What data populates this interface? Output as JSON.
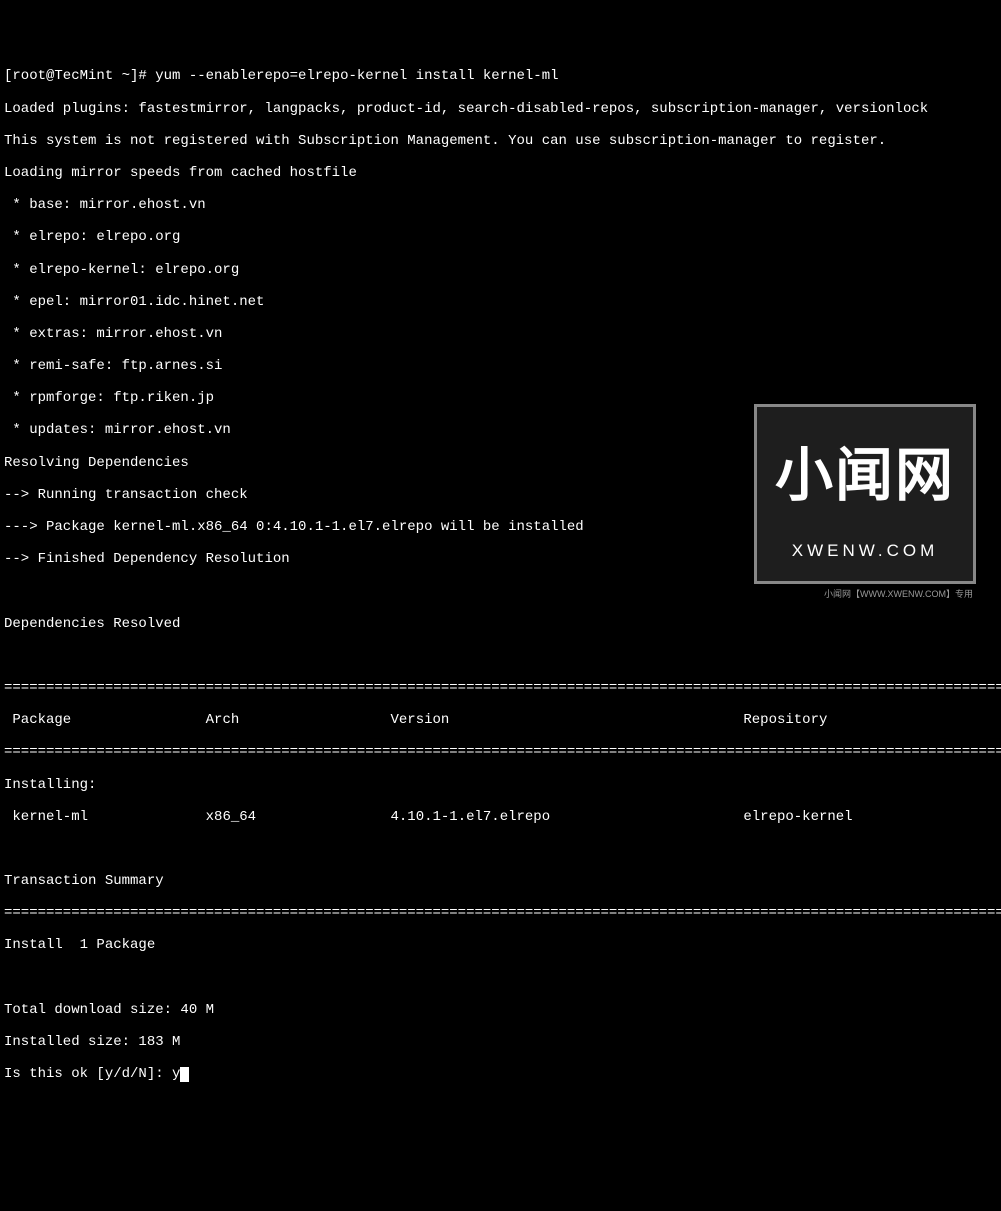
{
  "prompt": "[root@TecMint ~]# ",
  "command": "yum --enablerepo=elrepo-kernel install kernel-ml",
  "output": {
    "line1": "Loaded plugins: fastestmirror, langpacks, product-id, search-disabled-repos, subscription-manager, versionlock",
    "line2": "This system is not registered with Subscription Management. You can use subscription-manager to register.",
    "line3": "Loading mirror speeds from cached hostfile",
    "mirror1": " * base: mirror.ehost.vn",
    "mirror2": " * elrepo: elrepo.org",
    "mirror3": " * elrepo-kernel: elrepo.org",
    "mirror4": " * epel: mirror01.idc.hinet.net",
    "mirror5": " * extras: mirror.ehost.vn",
    "mirror6": " * remi-safe: ftp.arnes.si",
    "mirror7": " * rpmforge: ftp.riken.jp",
    "mirror8": " * updates: mirror.ehost.vn",
    "resolve1": "Resolving Dependencies",
    "resolve2": "--> Running transaction check",
    "resolve3": "---> Package kernel-ml.x86_64 0:4.10.1-1.el7.elrepo will be installed",
    "resolve4": "--> Finished Dependency Resolution",
    "deps_resolved": "Dependencies Resolved"
  },
  "divider": "===========================================================================================================================",
  "table": {
    "header": {
      "package": " Package",
      "arch": "Arch",
      "version": "Version",
      "repository": "Repository"
    },
    "installing_label": "Installing:",
    "row": {
      "package": " kernel-ml",
      "arch": "x86_64",
      "version": "4.10.1-1.el7.elrepo",
      "repository": "elrepo-kernel"
    }
  },
  "summary": {
    "title": "Transaction Summary",
    "install": "Install  1 Package",
    "download_size": "Total download size: 40 M",
    "installed_size": "Installed size: 183 M",
    "prompt": "Is this ok [y/d/N]: ",
    "response": "y"
  },
  "watermark": {
    "main": "小闻网",
    "sub": "XWENW.COM",
    "footer": "小闻网【WWW.XWENW.COM】专用"
  }
}
